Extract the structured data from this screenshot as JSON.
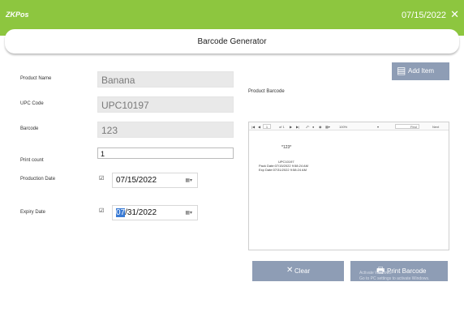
{
  "app": {
    "logo_zk": "ZK",
    "logo_pos": "Pos",
    "date": "07/15/2022",
    "close_glyph": "✕"
  },
  "panel": {
    "title": "Barcode Generator"
  },
  "form": {
    "product_name_label": "Product Name",
    "product_name_value": "Banana",
    "upc_label": "UPC Code",
    "upc_value": "UPC10197",
    "barcode_label": "Barcode",
    "barcode_value": "123",
    "print_count_label": "Print count",
    "print_count_value": "1",
    "production_date_label": "Production Date",
    "production_date_value": "07/15/2022",
    "expiry_date_label": "Expiry Date",
    "expiry_date_selected": "07",
    "expiry_date_rest": "/31/2022",
    "check_glyph": "☑",
    "cal_glyph": "▦▾"
  },
  "buttons": {
    "add_item": "Add Item",
    "clear": "Clear",
    "print_barcode": "Print Barcode"
  },
  "preview": {
    "label": "Product Barcode",
    "toolbar": {
      "nav_first": "|◀",
      "nav_prev": "◀",
      "page_num": "1",
      "page_of": "of 1",
      "nav_next": "▶",
      "nav_last": "▶|",
      "zoom": "100%",
      "find": "Find",
      "next": "Next"
    },
    "code_text": "*123*",
    "upc_text": "UPC10197",
    "pack_text": "Pack Date:07/15/2022 9:58:24 AM",
    "exp_text": "Exp Date:07/31/2022 9:58:24 AM"
  },
  "watermark": {
    "line1": "Activate Windows",
    "line2": "Go to PC settings to activate Windows."
  },
  "colors": {
    "header_green": "#8dc63f",
    "button_gray_blue": "#8e9db5",
    "field_gray": "#e9e9e9",
    "selection_blue": "#3a7bd5"
  }
}
